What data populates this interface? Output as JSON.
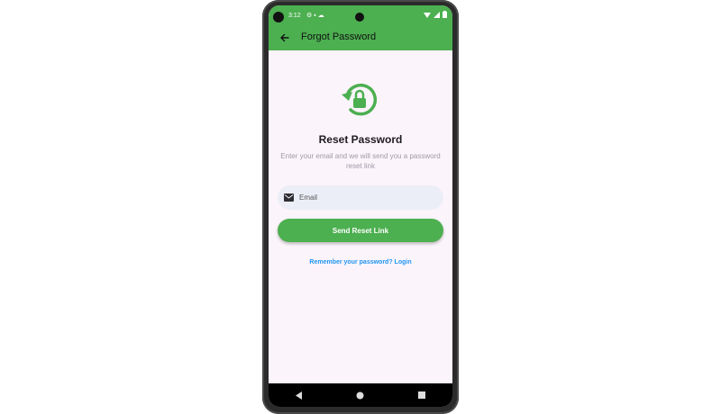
{
  "status_bar": {
    "time": "3:12",
    "left_icons": [
      "gear-icon",
      "sim-icon",
      "cloud-icon"
    ],
    "right_icons": [
      "wifi-icon",
      "signal-icon",
      "battery-icon"
    ]
  },
  "app_bar": {
    "title": "Forgot Password",
    "back_icon": "arrow-left-icon"
  },
  "main": {
    "hero_icon": "lock-reset-icon",
    "title": "Reset Password",
    "subtitle": "Enter your email and we will send you a password reset link",
    "email": {
      "placeholder": "Email",
      "value": "",
      "icon": "mail-icon"
    },
    "send_button_label": "Send Reset Link",
    "login_link_label": "Remember your password? Login"
  },
  "nav_bar": {
    "icons": [
      "back-triangle-icon",
      "home-circle-icon",
      "recents-square-icon"
    ]
  },
  "colors": {
    "accent": "#4caf50",
    "link": "#2196f3",
    "background": "#fcf4fb",
    "input_bg": "#eceef7"
  }
}
